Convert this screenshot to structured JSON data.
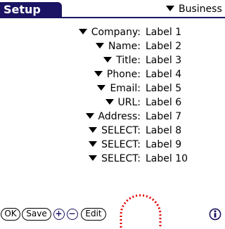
{
  "app": {
    "title": "Setup"
  },
  "category": {
    "selected": "Business"
  },
  "fields": [
    {
      "name": "Company:",
      "value": "Label 1"
    },
    {
      "name": "Name:",
      "value": "Label 2"
    },
    {
      "name": "Title:",
      "value": "Label 3"
    },
    {
      "name": "Phone:",
      "value": "Label 4"
    },
    {
      "name": "Email:",
      "value": "Label 5"
    },
    {
      "name": "URL:",
      "value": "Label 6"
    },
    {
      "name": "Address:",
      "value": "Label 7"
    },
    {
      "name": "SELECT:",
      "value": "Label 8"
    },
    {
      "name": "SELECT:",
      "value": "Label 9"
    },
    {
      "name": "SELECT:",
      "value": "Label 10"
    }
  ],
  "buttons": {
    "ok": "OK",
    "save": "Save",
    "plus": "+",
    "minus": "−",
    "edit": "Edit"
  },
  "icons": {
    "category_dropdown": "triangle-down-icon",
    "field_dropdown": "triangle-down-icon",
    "add": "plus-circle-icon",
    "remove": "minus-circle-icon",
    "info": "info-icon"
  },
  "colors": {
    "title_bar": "#1b1464",
    "annotation": "#e00000",
    "text": "#000000",
    "background": "#ffffff"
  }
}
